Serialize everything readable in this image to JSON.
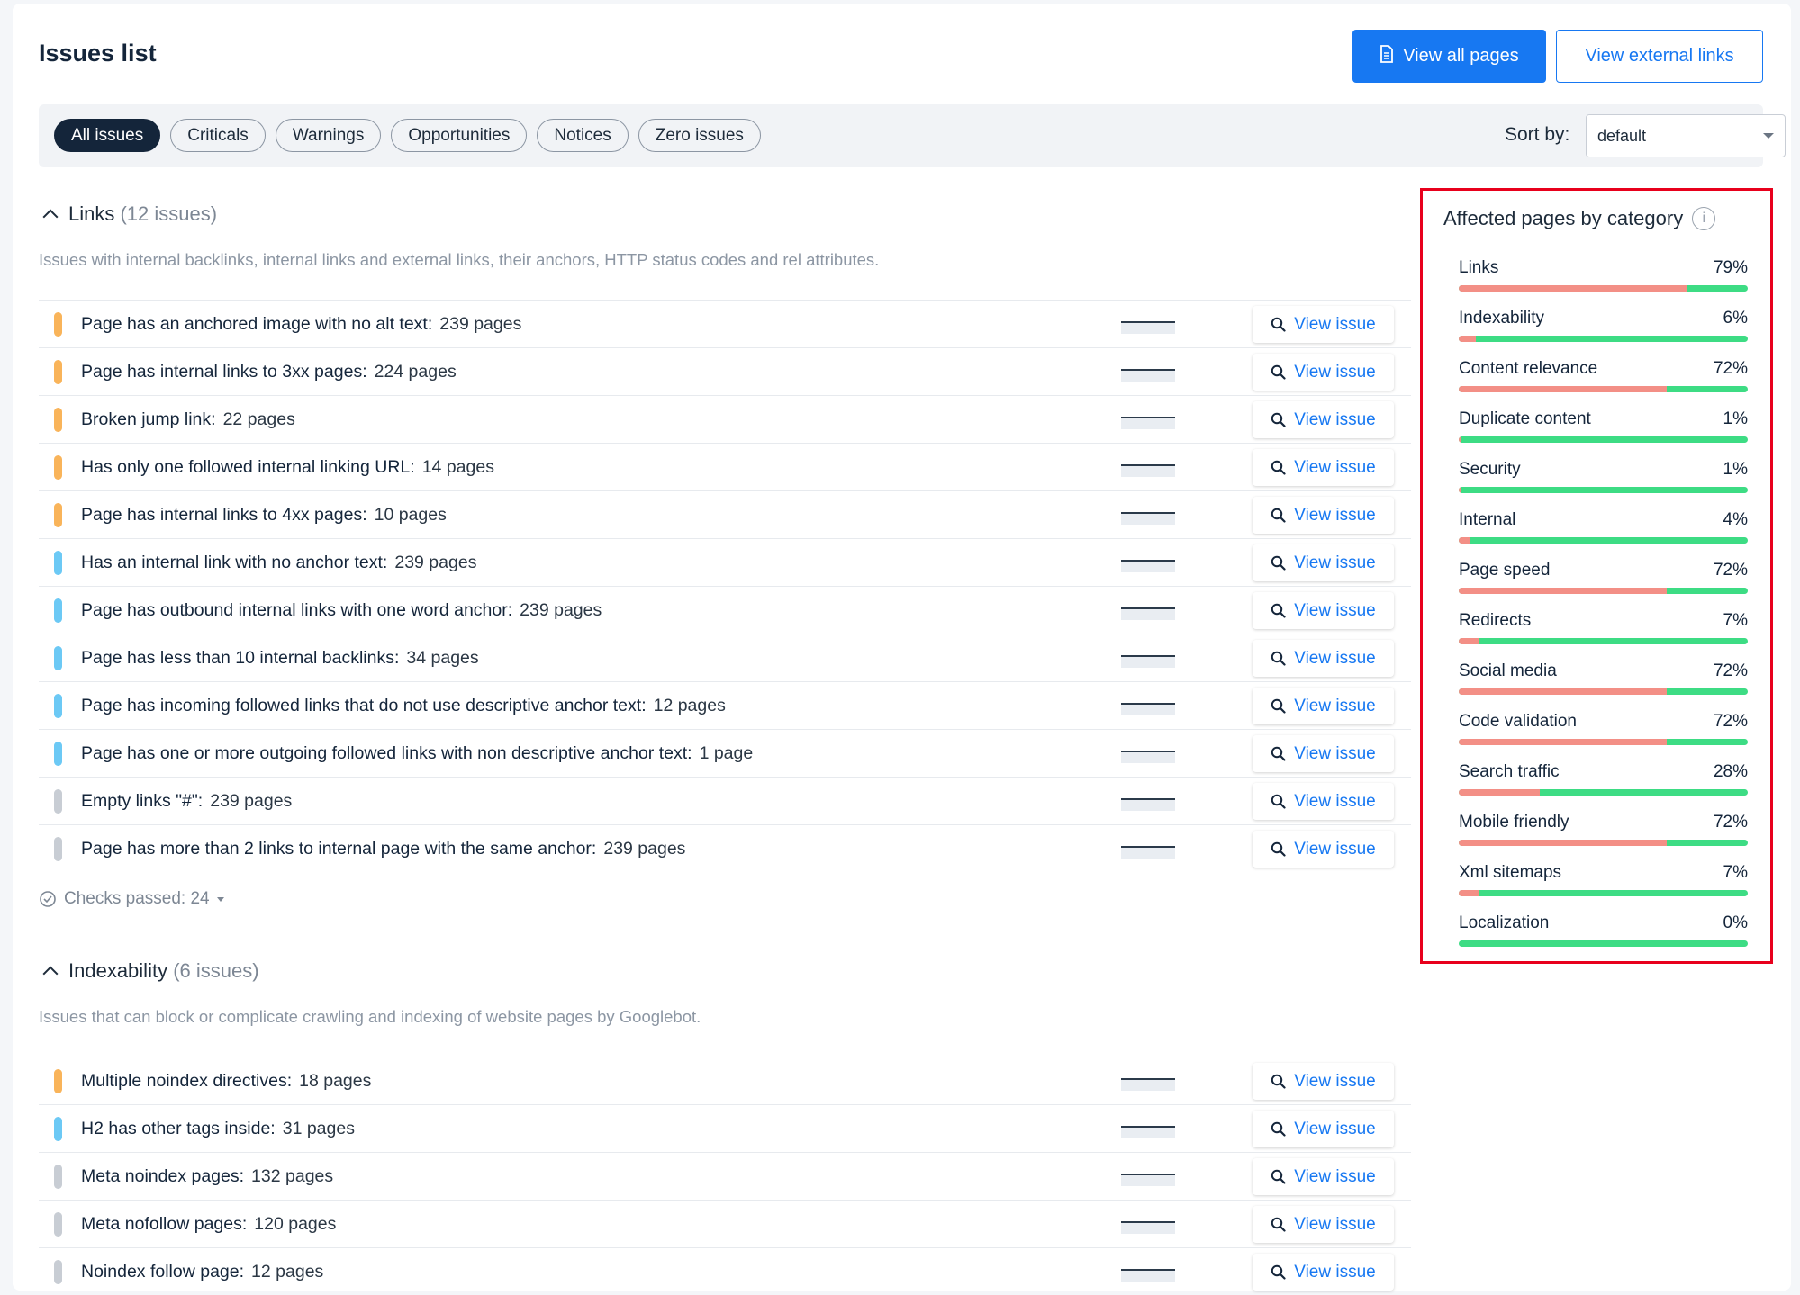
{
  "header": {
    "title": "Issues list",
    "view_all_pages": "View all pages",
    "view_external_links": "View external links"
  },
  "filters": {
    "chips": [
      "All issues",
      "Criticals",
      "Warnings",
      "Opportunities",
      "Notices",
      "Zero issues"
    ],
    "active": "All issues",
    "sort_label": "Sort by:",
    "sort_value": "default"
  },
  "colors": {
    "warning": "#f9b45a",
    "notice": "#6cc9f5",
    "zero": "#c8cdd4",
    "accent": "#1778f2",
    "bar_affected": "#f38f86",
    "bar_ok": "#3ddc84",
    "highlight_border": "#e8001c"
  },
  "view_issue_label": "View issue",
  "links_section": {
    "title": "Links",
    "count": "(12 issues)",
    "description": "Issues with internal backlinks, internal links and external links, their anchors, HTTP status codes and rel attributes.",
    "issues": [
      {
        "text": "Page has an anchored image with no alt text:",
        "pages": "239 pages",
        "severity": "warning"
      },
      {
        "text": "Page has internal links to 3xx pages:",
        "pages": "224 pages",
        "severity": "warning"
      },
      {
        "text": "Broken jump link:",
        "pages": "22 pages",
        "severity": "warning"
      },
      {
        "text": "Has only one followed internal linking URL:",
        "pages": "14 pages",
        "severity": "warning"
      },
      {
        "text": "Page has internal links to 4xx pages:",
        "pages": "10 pages",
        "severity": "warning"
      },
      {
        "text": "Has an internal link with no anchor text:",
        "pages": "239 pages",
        "severity": "notice"
      },
      {
        "text": "Page has outbound internal links with one word anchor:",
        "pages": "239 pages",
        "severity": "notice"
      },
      {
        "text": "Page has less than 10 internal backlinks:",
        "pages": "34 pages",
        "severity": "notice"
      },
      {
        "text": "Page has incoming followed links that do not use descriptive anchor text:",
        "pages": "12 pages",
        "severity": "notice"
      },
      {
        "text": "Page has one or more outgoing followed links with non descriptive anchor text:",
        "pages": "1 page",
        "severity": "notice"
      },
      {
        "text": "Empty links \"#\":",
        "pages": "239 pages",
        "severity": "zero"
      },
      {
        "text": "Page has more than 2 links to internal page with the same anchor:",
        "pages": "239 pages",
        "severity": "zero"
      }
    ],
    "checks_passed": "Checks passed: 24"
  },
  "indexability_section": {
    "title": "Indexability",
    "count": "(6 issues)",
    "description": "Issues that can block or complicate crawling and indexing of website pages by Googlebot.",
    "issues": [
      {
        "text": "Multiple noindex directives:",
        "pages": "18 pages",
        "severity": "warning"
      },
      {
        "text": "H2 has other tags inside:",
        "pages": "31 pages",
        "severity": "notice"
      },
      {
        "text": "Meta noindex pages:",
        "pages": "132 pages",
        "severity": "zero"
      },
      {
        "text": "Meta nofollow pages:",
        "pages": "120 pages",
        "severity": "zero"
      },
      {
        "text": "Noindex follow page:",
        "pages": "12 pages",
        "severity": "zero"
      }
    ]
  },
  "affected_panel": {
    "title": "Affected pages by category",
    "categories": [
      {
        "name": "Links",
        "pct_label": "79%",
        "value": 79
      },
      {
        "name": "Indexability",
        "pct_label": "6%",
        "value": 6
      },
      {
        "name": "Content relevance",
        "pct_label": "72%",
        "value": 72
      },
      {
        "name": "Duplicate content",
        "pct_label": "1%",
        "value": 1
      },
      {
        "name": "Security",
        "pct_label": "1%",
        "value": 1
      },
      {
        "name": "Internal",
        "pct_label": "4%",
        "value": 4
      },
      {
        "name": "Page speed",
        "pct_label": "72%",
        "value": 72
      },
      {
        "name": "Redirects",
        "pct_label": "7%",
        "value": 7
      },
      {
        "name": "Social media",
        "pct_label": "72%",
        "value": 72
      },
      {
        "name": "Code validation",
        "pct_label": "72%",
        "value": 72
      },
      {
        "name": "Search traffic",
        "pct_label": "28%",
        "value": 28
      },
      {
        "name": "Mobile friendly",
        "pct_label": "72%",
        "value": 72
      },
      {
        "name": "Xml sitemaps",
        "pct_label": "7%",
        "value": 7
      },
      {
        "name": "Localization",
        "pct_label": "0%",
        "value": 0
      }
    ]
  }
}
